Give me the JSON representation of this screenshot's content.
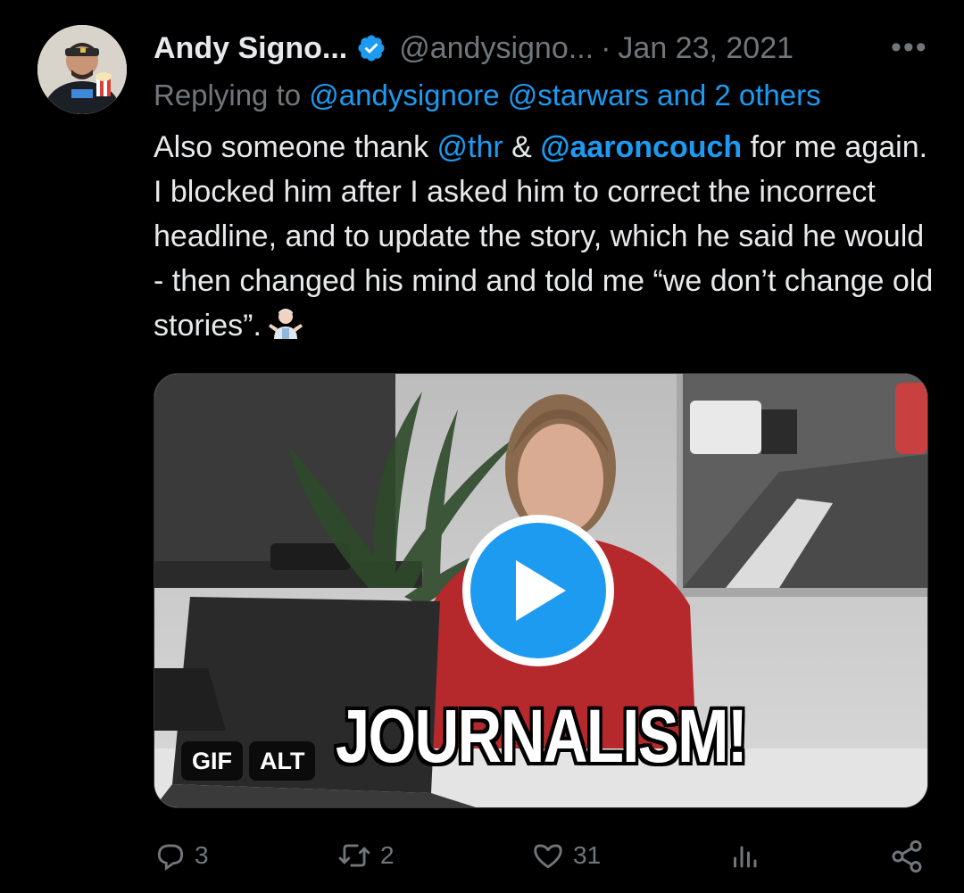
{
  "tweet": {
    "author_name": "Andy Signo...",
    "handle": "@andysigno...",
    "separator": "·",
    "date": "Jan 23, 2021",
    "more_label": "•••",
    "replying_prefix": "Replying to",
    "replying_users": "@andysignore @starwars",
    "replying_and": "and",
    "replying_others": "2 others",
    "text_1": "Also someone thank ",
    "mention_1": "@thr",
    "text_2": " & ",
    "mention_2": "@aaroncouch",
    "text_3": " for me again. I blocked him after I asked him to correct the incorrect headline, and to update the story, which he said he would - then changed his mind and told me “we don’t change old stories”."
  },
  "media": {
    "overlay_caption": "JOURNALISM!",
    "gif_badge": "GIF",
    "alt_badge": "ALT"
  },
  "actions": {
    "reply_count": "3",
    "retweet_count": "2",
    "like_count": "31"
  },
  "icons": {
    "verified": "verified-badge-icon",
    "more": "more-icon",
    "play": "play-icon",
    "reply": "reply-icon",
    "retweet": "retweet-icon",
    "like": "like-icon",
    "views": "views-icon",
    "share": "share-icon",
    "emoji": "shrug-emoji-icon"
  },
  "colors": {
    "background": "#000000",
    "text": "#e7e9ea",
    "muted": "#71767b",
    "accent": "#1d9bf0"
  }
}
